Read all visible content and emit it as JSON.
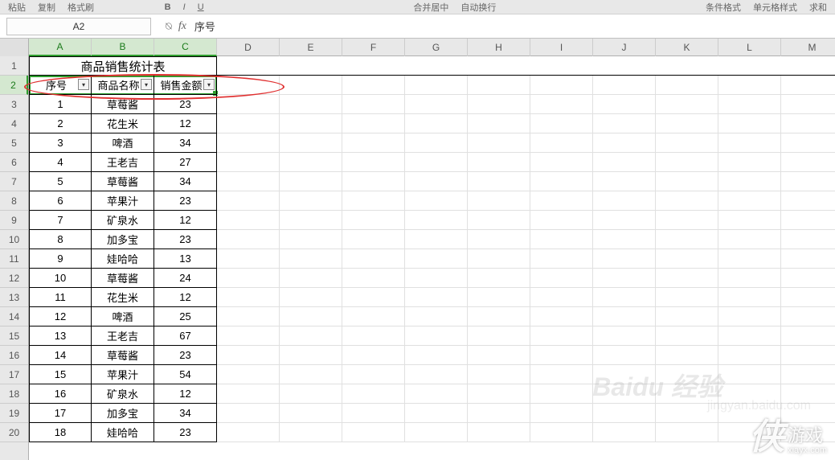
{
  "toolbar": {
    "items": [
      "粘贴",
      "复制",
      "格式刷"
    ],
    "right_items": [
      "合并居中",
      "自动换行",
      "条件格式",
      "单元格样式",
      "求和"
    ]
  },
  "formula_bar": {
    "name_box": "A2",
    "fx_label": "fx",
    "formula": "序号"
  },
  "columns": [
    "A",
    "B",
    "C",
    "D",
    "E",
    "F",
    "G",
    "H",
    "I",
    "J",
    "K",
    "L",
    "M"
  ],
  "selected_cols": [
    "A",
    "B",
    "C"
  ],
  "selected_row": 2,
  "table": {
    "title": "商品销售统计表",
    "headers": [
      "序号",
      "商品名称",
      "销售金额"
    ],
    "rows": [
      {
        "n": "1",
        "name": "草莓酱",
        "amt": "23"
      },
      {
        "n": "2",
        "name": "花生米",
        "amt": "12"
      },
      {
        "n": "3",
        "name": "啤酒",
        "amt": "34"
      },
      {
        "n": "4",
        "name": "王老吉",
        "amt": "27"
      },
      {
        "n": "5",
        "name": "草莓酱",
        "amt": "34"
      },
      {
        "n": "6",
        "name": "苹果汁",
        "amt": "23"
      },
      {
        "n": "7",
        "name": "矿泉水",
        "amt": "12"
      },
      {
        "n": "8",
        "name": "加多宝",
        "amt": "23"
      },
      {
        "n": "9",
        "name": "娃哈哈",
        "amt": "13"
      },
      {
        "n": "10",
        "name": "草莓酱",
        "amt": "24"
      },
      {
        "n": "11",
        "name": "花生米",
        "amt": "12"
      },
      {
        "n": "12",
        "name": "啤酒",
        "amt": "25"
      },
      {
        "n": "13",
        "name": "王老吉",
        "amt": "67"
      },
      {
        "n": "14",
        "name": "草莓酱",
        "amt": "23"
      },
      {
        "n": "15",
        "name": "苹果汁",
        "amt": "54"
      },
      {
        "n": "16",
        "name": "矿泉水",
        "amt": "12"
      },
      {
        "n": "17",
        "name": "加多宝",
        "amt": "34"
      },
      {
        "n": "18",
        "name": "娃哈哈",
        "amt": "23"
      }
    ]
  },
  "watermark": {
    "brand_char": "侠",
    "brand_text": "游戏",
    "url": "xiayx.com",
    "faint1": "Baidu 经验",
    "faint2": "jingyan.baidu.com"
  }
}
